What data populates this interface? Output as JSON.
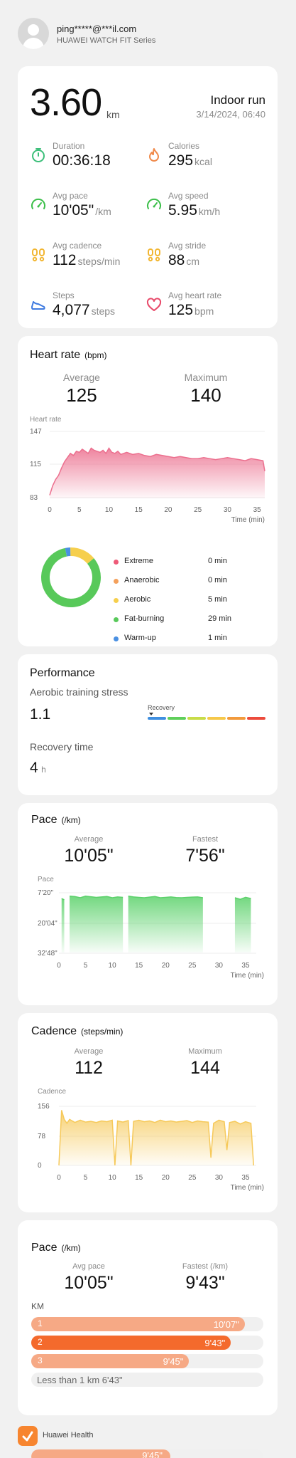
{
  "header": {
    "account": "ping*****@***il.com",
    "device": "HUAWEI WATCH FIT Series"
  },
  "summary": {
    "distance": "3.60",
    "distance_unit": "km",
    "activity": "Indoor run",
    "datetime": "3/14/2024, 06:40",
    "metrics": [
      {
        "label": "Duration",
        "value": "00:36:18",
        "unit": "",
        "icon": "timer-icon",
        "color": "#3cbf7a"
      },
      {
        "label": "Calories",
        "value": "295",
        "unit": "kcal",
        "icon": "flame-icon",
        "color": "#f08a4b"
      },
      {
        "label": "Avg pace",
        "value": "10'05\"",
        "unit": "/km",
        "icon": "speedometer-icon",
        "color": "#3cbf4a"
      },
      {
        "label": "Avg speed",
        "value": "5.95",
        "unit": "km/h",
        "icon": "speedometer-icon",
        "color": "#3cbf4a"
      },
      {
        "label": "Avg cadence",
        "value": "112",
        "unit": "steps/min",
        "icon": "footprints-icon",
        "color": "#f2b632"
      },
      {
        "label": "Avg stride",
        "value": "88",
        "unit": "cm",
        "icon": "footprints-icon",
        "color": "#f2b632"
      },
      {
        "label": "Steps",
        "value": "4,077",
        "unit": "steps",
        "icon": "shoe-icon",
        "color": "#3f7be0"
      },
      {
        "label": "Avg heart rate",
        "value": "125",
        "unit": "bpm",
        "icon": "heart-icon",
        "color": "#e84a6a"
      }
    ]
  },
  "heart_rate": {
    "title": "Heart rate",
    "unit": "(bpm)",
    "average_label": "Average",
    "average": "125",
    "maximum_label": "Maximum",
    "maximum": "140",
    "chart_label": "Heart rate",
    "zones": [
      {
        "name": "Extreme",
        "minutes": "0 min",
        "color": "#ee5a78",
        "value": 0
      },
      {
        "name": "Anaerobic",
        "minutes": "0 min",
        "color": "#f4a05b",
        "value": 0
      },
      {
        "name": "Aerobic",
        "minutes": "5 min",
        "color": "#f6cf4d",
        "value": 5
      },
      {
        "name": "Fat-burning",
        "minutes": "29 min",
        "color": "#58c95a",
        "value": 29
      },
      {
        "name": "Warm-up",
        "minutes": "1 min",
        "color": "#4a90e2",
        "value": 1
      }
    ]
  },
  "performance": {
    "title": "Performance",
    "ats_label": "Aerobic training stress",
    "ats_value": "1.1",
    "scale_label": "Recovery",
    "scale_colors": [
      "#3f8fe0",
      "#5fcf5a",
      "#c8dc48",
      "#f6c84a",
      "#f29a3c",
      "#ec4b3c"
    ],
    "recovery_label": "Recovery time",
    "recovery_value": "4",
    "recovery_unit": "h"
  },
  "pace": {
    "title": "Pace",
    "unit": "(/km)",
    "average_label": "Average",
    "average": "10'05\"",
    "fastest_label": "Fastest",
    "fastest": "7'56\"",
    "chart_label": "Pace"
  },
  "cadence": {
    "title": "Cadence",
    "unit": "(steps/min)",
    "average_label": "Average",
    "average": "112",
    "maximum_label": "Maximum",
    "maximum": "144",
    "chart_label": "Cadence"
  },
  "splits": {
    "title": "Pace",
    "unit": "(/km)",
    "avg_label": "Avg pace",
    "avg": "10'05\"",
    "fastest_label": "Fastest (/km)",
    "fastest": "9'43\"",
    "km_label": "KM",
    "rows": [
      {
        "km": "1",
        "pace": "10'07\"",
        "fraction": 0.92,
        "color": "#f6a985"
      },
      {
        "km": "2",
        "pace": "9'43\"",
        "fraction": 0.86,
        "color": "#f46a2c"
      },
      {
        "km": "3",
        "pace": "9'45\"",
        "fraction": 0.68,
        "color": "#f6a985"
      }
    ],
    "remainder": "Less than 1 km 6'43\"",
    "partial_row": {
      "pace": "9'45\"",
      "fraction": 0.6,
      "color": "#f6a985"
    }
  },
  "footer": {
    "app_name": "Huawei Health",
    "brand_color": "#f7852f"
  },
  "chart_data": [
    {
      "type": "area",
      "title": "Heart rate",
      "ylabel": "Heart rate",
      "xlabel": "Time (min)",
      "x_ticks": [
        "0",
        "5",
        "10",
        "15",
        "20",
        "25",
        "30",
        "35"
      ],
      "y_ticks": [
        "147",
        "115",
        "83"
      ],
      "ylim": [
        83,
        147
      ],
      "xlim": [
        0,
        36.3
      ],
      "color": "#ec6f8e",
      "x": [
        0,
        0.5,
        1,
        1.5,
        2,
        2.5,
        3,
        3.5,
        4,
        4.5,
        5,
        5.5,
        6,
        6.5,
        7,
        7.5,
        8,
        8.5,
        9,
        9.5,
        10,
        10.5,
        11,
        11.5,
        12,
        13,
        14,
        15,
        16,
        17,
        18,
        19,
        20,
        21,
        22,
        23,
        24,
        25,
        26,
        27,
        28,
        29,
        30,
        31,
        32,
        33,
        34,
        35,
        36,
        36.3
      ],
      "y": [
        86,
        95,
        101,
        105,
        112,
        118,
        122,
        126,
        124,
        128,
        127,
        130,
        128,
        126,
        131,
        129,
        128,
        127,
        129,
        126,
        131,
        127,
        126,
        128,
        125,
        127,
        125,
        126,
        124,
        123,
        125,
        124,
        123,
        122,
        123,
        122,
        121,
        121,
        122,
        121,
        120,
        121,
        122,
        121,
        120,
        119,
        121,
        120,
        119,
        109
      ]
    },
    {
      "type": "area",
      "title": "Pace",
      "ylabel": "Pace",
      "xlabel": "Time (min)",
      "x_ticks": [
        "0",
        "5",
        "10",
        "15",
        "20",
        "25",
        "30",
        "35"
      ],
      "y_ticks": [
        "7'20\"",
        "20'04\"",
        "32'48\""
      ],
      "ylim_seconds": [
        440,
        1968
      ],
      "xlim": [
        0,
        37
      ],
      "color": "#5bd16a",
      "x": [
        0,
        0.5,
        1,
        1.5,
        2,
        3,
        4,
        5,
        6,
        7,
        8,
        9,
        10,
        11,
        12,
        12.5,
        13,
        14,
        15,
        16,
        17,
        18,
        19,
        20,
        21,
        22,
        23,
        24,
        25,
        26,
        27,
        27.5,
        28,
        29,
        30,
        31,
        32,
        32.5,
        33,
        34,
        35,
        36,
        36.5
      ],
      "y_seconds": [
        1968,
        620,
        650,
        1968,
        560,
        570,
        600,
        560,
        575,
        590,
        580,
        570,
        600,
        580,
        590,
        1968,
        560,
        580,
        590,
        600,
        585,
        570,
        600,
        590,
        580,
        595,
        600,
        590,
        585,
        580,
        600,
        1968,
        1968,
        1968,
        1968,
        1968,
        1968,
        1968,
        600,
        640,
        590,
        620,
        1968
      ]
    },
    {
      "type": "area",
      "title": "Cadence",
      "ylabel": "Cadence",
      "xlabel": "Time (min)",
      "x_ticks": [
        "0",
        "5",
        "10",
        "15",
        "20",
        "25",
        "30",
        "35"
      ],
      "y_ticks": [
        "156",
        "78",
        "0"
      ],
      "ylim": [
        0,
        156
      ],
      "xlim": [
        0,
        37
      ],
      "color": "#f6c95a",
      "x": [
        0,
        0.5,
        1,
        1.5,
        2,
        3,
        4,
        5,
        6,
        7,
        8,
        9,
        10,
        10.5,
        11,
        12,
        13,
        13.5,
        14,
        15,
        16,
        17,
        18,
        19,
        20,
        21,
        22,
        23,
        24,
        25,
        26,
        27,
        28,
        28.5,
        29,
        30,
        31,
        31.5,
        32,
        33,
        34,
        35,
        36,
        36.5
      ],
      "y": [
        0,
        144,
        120,
        110,
        120,
        112,
        118,
        113,
        115,
        112,
        116,
        114,
        118,
        0,
        116,
        113,
        117,
        0,
        115,
        118,
        114,
        116,
        112,
        118,
        114,
        116,
        113,
        115,
        117,
        112,
        116,
        114,
        113,
        20,
        110,
        118,
        114,
        40,
        112,
        115,
        108,
        114,
        110,
        0
      ]
    }
  ]
}
